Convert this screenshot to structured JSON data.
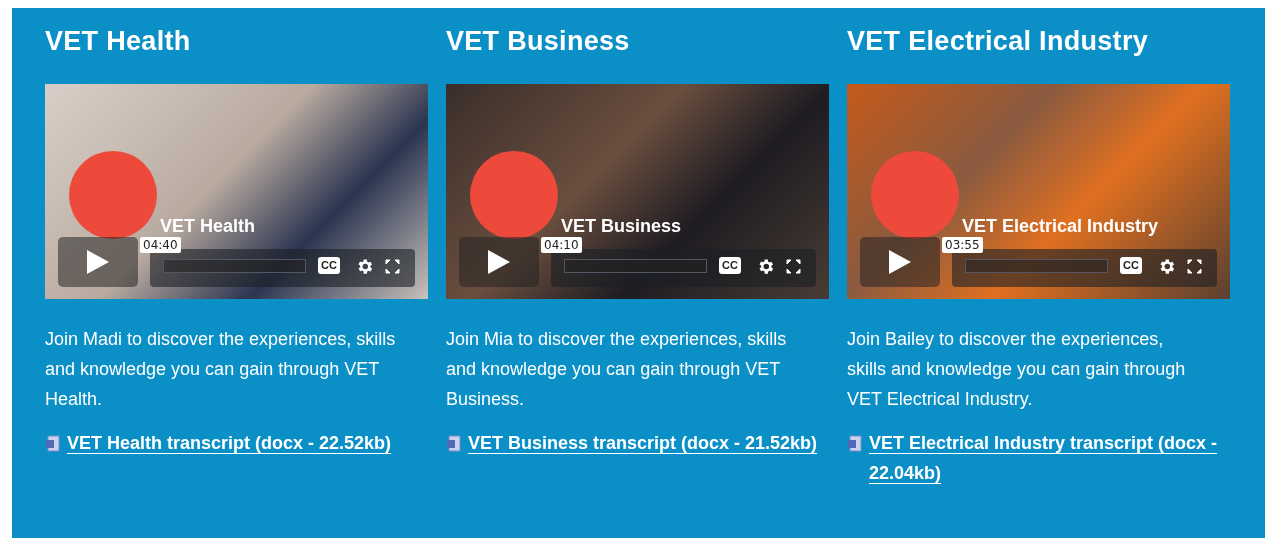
{
  "cards": [
    {
      "heading": "VET Health",
      "video": {
        "title": "VET Health",
        "duration": "04:40",
        "cc": "CC"
      },
      "description": "Join Madi to discover the experiences, skills and knowledge you can gain through VET Health.",
      "link": "VET Health transcript (docx - 22.52kb)"
    },
    {
      "heading": "VET Business",
      "video": {
        "title": "VET Business",
        "duration": "04:10",
        "cc": "CC"
      },
      "description": "Join Mia to discover the experiences, skills and knowledge you can gain through VET Business.",
      "link": "VET Business transcript (docx - 21.52kb)"
    },
    {
      "heading": "VET Electrical Industry",
      "video": {
        "title": "VET Electrical Industry",
        "duration": "03:55",
        "cc": "CC"
      },
      "description": "Join Bailey to discover the experiences, skills and knowledge you can gain through VET Electrical Industry.",
      "link": "VET Electrical Industry transcript (docx - 22.04kb)"
    }
  ]
}
